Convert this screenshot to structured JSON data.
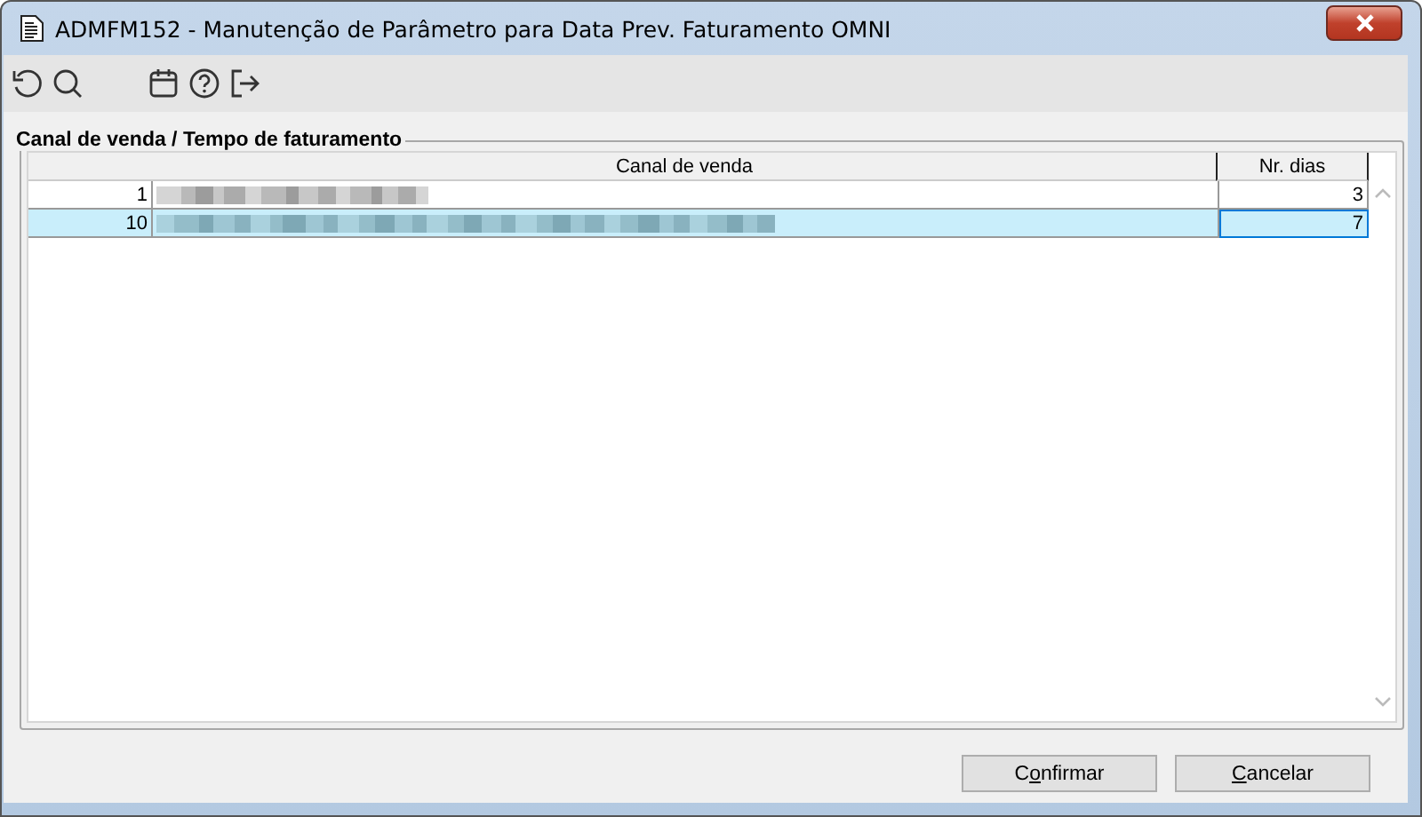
{
  "window": {
    "title": "ADMFM152 - Manutenção de Parâmetro para Data Prev. Faturamento OMNI"
  },
  "toolbar": [
    {
      "kind": "undo"
    },
    {
      "kind": "search"
    },
    {
      "kind": "gap"
    },
    {
      "kind": "calendar"
    },
    {
      "kind": "help"
    },
    {
      "kind": "exit"
    }
  ],
  "group": {
    "title": "Canal de venda / Tempo de faturamento"
  },
  "table": {
    "columns": [
      "",
      "Canal de venda",
      "Nr. dias"
    ],
    "rows": [
      {
        "id": "1",
        "redacted": true,
        "days": "3",
        "selected": false
      },
      {
        "id": "10",
        "redacted": true,
        "days": "7",
        "selected": true
      }
    ]
  },
  "buttons": [
    {
      "lead": "C",
      "accel": "o",
      "rest": "nfirmar"
    },
    {
      "accel": "C",
      "rest": "ancelar"
    }
  ]
}
